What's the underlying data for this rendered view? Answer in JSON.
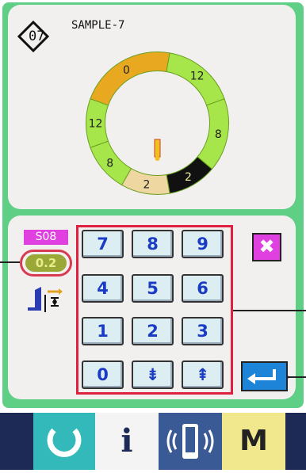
{
  "header": {
    "pattern_number": "07",
    "pattern_name": "SAMPLE-7"
  },
  "ring": {
    "segments": [
      {
        "label": "0",
        "color": "#e8a820"
      },
      {
        "label": "12",
        "color": "#a6e64a"
      },
      {
        "label": "8",
        "color": "#a6e64a"
      },
      {
        "label": "2",
        "color": "#111111"
      },
      {
        "label": "2",
        "color": "#eed7a0"
      },
      {
        "label": "8",
        "color": "#a6e64a"
      },
      {
        "label": "12",
        "color": "#a6e64a"
      }
    ]
  },
  "settings": {
    "item_code": "S08",
    "value": "0.2",
    "adjust_icon": "needle-height-adjust-icon"
  },
  "keypad": {
    "keys": [
      "7",
      "8",
      "9",
      "4",
      "5",
      "6",
      "1",
      "2",
      "3",
      "0",
      "⇟",
      "⇞"
    ],
    "clear_label": "✖",
    "enter_icon": "enter-icon"
  },
  "bottom_bar": {
    "tabs": [
      {
        "name": "refresh-icon"
      },
      {
        "name": "info-icon",
        "label": "i"
      },
      {
        "name": "communication-icon"
      },
      {
        "name": "menu",
        "label": "M"
      }
    ]
  },
  "colors": {
    "screen_green": "#5fcf86",
    "frame_red": "#e02040",
    "key_text_blue": "#1a3cc4",
    "magenta": "#e040e0"
  }
}
